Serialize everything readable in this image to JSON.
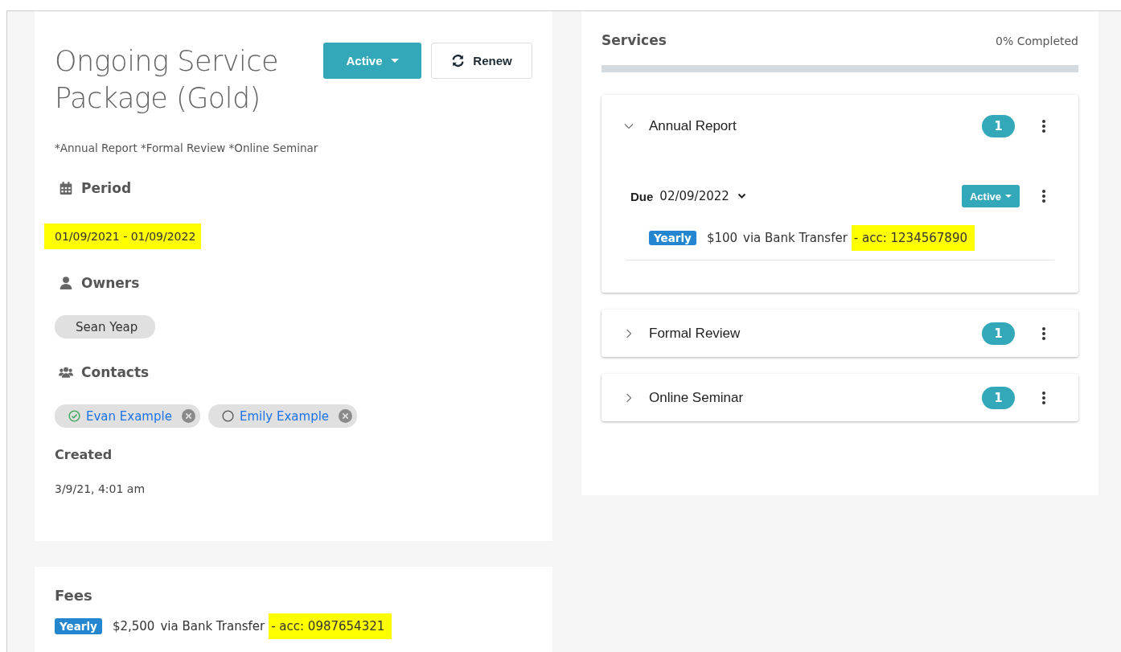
{
  "package": {
    "title": "Ongoing Service Package (Gold)",
    "status_button": "Active",
    "renew_button": "Renew",
    "subtitle": "*Annual Report *Formal Review *Online Seminar",
    "period": {
      "heading": "Period",
      "value": "01/09/2021 - 01/09/2022",
      "highlighted": true
    },
    "owners": {
      "heading": "Owners",
      "chips": [
        "Sean Yeap"
      ]
    },
    "contacts": {
      "heading": "Contacts",
      "chips": [
        {
          "name": "Evan Example",
          "confirmed": true
        },
        {
          "name": "Emily Example",
          "confirmed": false
        }
      ]
    },
    "created": {
      "heading": "Created",
      "value": "3/9/21, 4:01 am"
    }
  },
  "fees": {
    "heading": "Fees",
    "rows": [
      {
        "frequency": "Yearly",
        "amount": "$2,500",
        "method": "via Bank Transfer",
        "account": "- acc: 0987654321",
        "highlighted": true
      }
    ]
  },
  "services": {
    "heading": "Services",
    "completed": "0% Completed",
    "level": 0,
    "items": [
      {
        "name": "Annual Report",
        "count": "1",
        "expanded": true,
        "entries": [
          {
            "due_label": "Due",
            "due": "02/09/2022",
            "status": "Active",
            "frequency": "Yearly",
            "amount": "$100",
            "method": "via Bank Transfer",
            "account": "- acc: 1234567890",
            "highlighted": true
          }
        ]
      },
      {
        "name": "Formal Review",
        "count": "1",
        "expanded": false
      },
      {
        "name": "Online Seminar",
        "count": "1",
        "expanded": false
      }
    ]
  }
}
